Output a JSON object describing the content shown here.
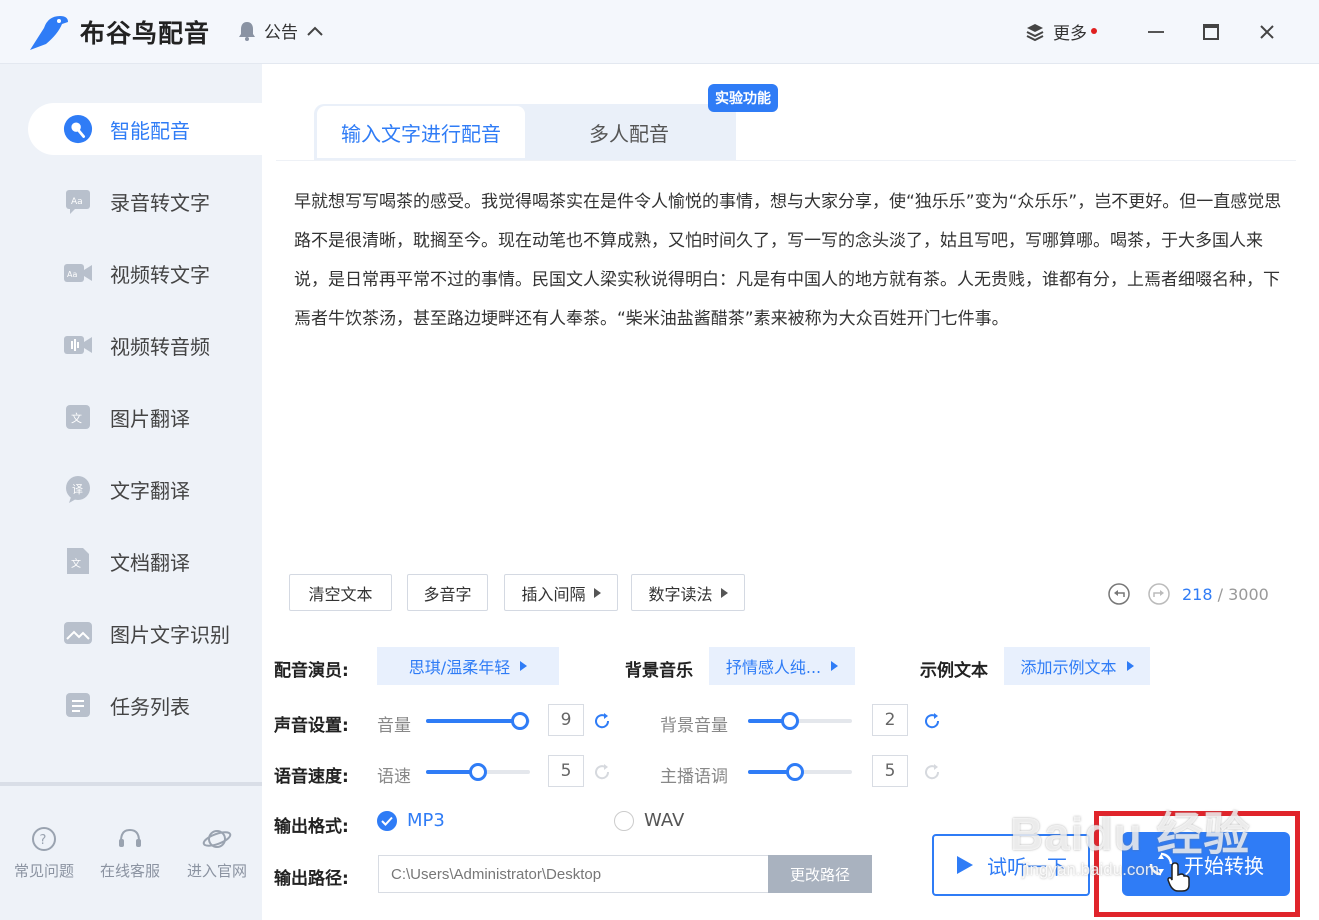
{
  "app": {
    "title": "布谷鸟配音",
    "notice_label": "公告",
    "more_label": "更多"
  },
  "sidebar": {
    "items": [
      {
        "label": "智能配音",
        "icon": "mic-icon",
        "active": true
      },
      {
        "label": "录音转文字",
        "icon": "audio-text-icon",
        "active": false
      },
      {
        "label": "视频转文字",
        "icon": "video-text-icon",
        "active": false
      },
      {
        "label": "视频转音频",
        "icon": "video-audio-icon",
        "active": false
      },
      {
        "label": "图片翻译",
        "icon": "image-translate-icon",
        "active": false
      },
      {
        "label": "文字翻译",
        "icon": "text-translate-icon",
        "active": false
      },
      {
        "label": "文档翻译",
        "icon": "doc-translate-icon",
        "active": false
      },
      {
        "label": "图片文字识别",
        "icon": "ocr-icon",
        "active": false
      },
      {
        "label": "任务列表",
        "icon": "task-list-icon",
        "active": false
      }
    ],
    "bottom_links": [
      {
        "label": "常见问题",
        "icon": "help-icon"
      },
      {
        "label": "在线客服",
        "icon": "headset-icon"
      },
      {
        "label": "进入官网",
        "icon": "planet-icon"
      }
    ]
  },
  "tabs": [
    {
      "label": "输入文字进行配音",
      "active": true
    },
    {
      "label": "多人配音",
      "active": false
    }
  ],
  "badge": "实验功能",
  "editor": {
    "text": "早就想写写喝茶的感受。我觉得喝茶实在是件令人愉悦的事情，想与大家分享，使“独乐乐”变为“众乐乐”，岂不更好。但一直感觉思路不是很清晰，耽搁至今。现在动笔也不算成熟，又怕时间久了，写一写的念头淡了，姑且写吧，写哪算哪。喝茶，于大多国人来说，是日常再平常不过的事情。民国文人梁实秋说得明白：凡是有中国人的地方就有茶。人无贵贱，谁都有分，上焉者细啜名种，下焉者牛饮茶汤，甚至路边埂畔还有人奉茶。“柴米油盐酱醋茶”素来被称为大众百姓开门七件事。",
    "count": "218",
    "max": "/ 3000"
  },
  "tools": {
    "clear": "清空文本",
    "polyphone": "多音字",
    "insert_pause": "插入间隔",
    "number_reading": "数字读法"
  },
  "voice": {
    "actor_label": "配音演员:",
    "actor_value": "思琪/温柔年轻",
    "bgm_label": "背景音乐",
    "bgm_value": "抒情感人纯...",
    "sample_label": "示例文本",
    "sample_value": "添加示例文本"
  },
  "sound": {
    "label": "声音设置:",
    "volume_label": "音量",
    "volume_value": "9",
    "volume_fraction": 0.9,
    "bg_volume_label": "背景音量",
    "bg_volume_value": "2",
    "bg_volume_fraction": 0.4
  },
  "speed": {
    "label": "语音速度:",
    "speed_label": "语速",
    "speed_value": "5",
    "speed_fraction": 0.5,
    "pitch_label": "主播语调",
    "pitch_value": "5",
    "pitch_fraction": 0.45
  },
  "output": {
    "format_label": "输出格式:",
    "mp3": "MP3",
    "wav": "WAV",
    "selected": "MP3",
    "path_label": "输出路径:",
    "path_value": "C:\\Users\\Administrator\\Desktop",
    "change_path": "更改路径"
  },
  "actions": {
    "listen": "试听一下",
    "start": "开始转换"
  },
  "watermark": {
    "main": "Baidu 经验",
    "sub": "jingyan.baidu.com"
  },
  "colors": {
    "accent": "#2f7cf6",
    "highlight": "#e0242b",
    "sidebar_bg": "#eef2f8"
  }
}
